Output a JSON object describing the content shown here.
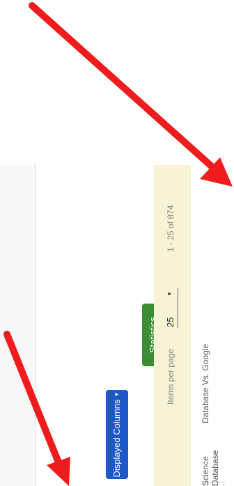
{
  "toolbar": {
    "displayed_columns_label": "Displayed Columns",
    "statistics_label": "Statistics"
  },
  "pager": {
    "items_per_page_label": "Items per page",
    "page_size": "25",
    "range_text": "1 - 25 of 874"
  },
  "table": {
    "columns": [
      "Science Database",
      "Database Vs. Google"
    ]
  },
  "colors": {
    "primary_button": "#1f56c8",
    "success_button": "#3c8d34",
    "pager_background": "#f7f3d4",
    "annotation_arrow": "#ee1c1c"
  },
  "icons": [
    "caret-down-icon",
    "dropdown-caret-icon",
    "annotation-arrow"
  ]
}
